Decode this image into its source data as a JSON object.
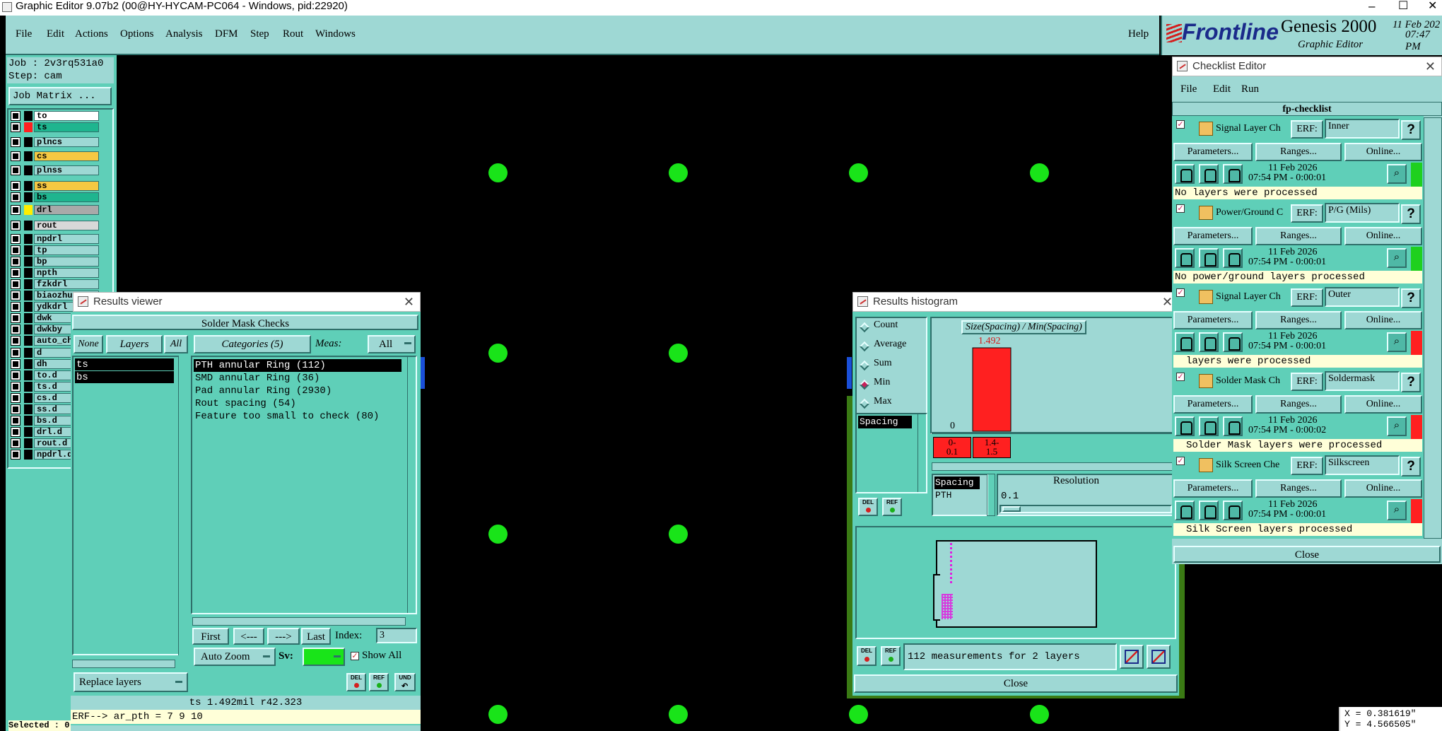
{
  "window": {
    "title": "Graphic Editor 9.07b2 (00@HY-HYCAM-PC064 - Windows, pid:22920)",
    "controls": [
      "–",
      "☐",
      "✕"
    ]
  },
  "menubar": {
    "items": [
      "File",
      "Edit",
      "Actions",
      "Options",
      "Analysis",
      "DFM",
      "Step",
      "Rout",
      "Windows"
    ],
    "help": "Help"
  },
  "brand": {
    "logo": "Frontline",
    "product": "Genesis 2000",
    "subtitle": "Graphic Editor",
    "date": "11 Feb 202",
    "time": "07:47 PM"
  },
  "job": {
    "job": "Job : 2v3rq531a0",
    "step": "Step: cam",
    "matrix_btn": "Job Matrix ..."
  },
  "layers": [
    {
      "name": "to",
      "color": "#ffffff",
      "swatch": "#000000"
    },
    {
      "name": "ts",
      "color": "#1fb58f",
      "swatch": "#ff2020"
    },
    {
      "name": "plncs",
      "color": "#9ed8d4",
      "swatch": "#000000"
    },
    {
      "name": "cs",
      "color": "#f5c842",
      "swatch": "#000000"
    },
    {
      "name": "plnss",
      "color": "#9ed8d4",
      "swatch": "#000000"
    },
    {
      "name": "ss",
      "color": "#f5c842",
      "swatch": "#000000"
    },
    {
      "name": "bs",
      "color": "#1fb58f",
      "swatch": "#000000"
    },
    {
      "name": "drl",
      "color": "#a9a9a9",
      "swatch": "#ffee00"
    },
    {
      "name": "rout",
      "color": "#d8d8d8",
      "swatch": "#000000"
    },
    {
      "name": "npdrl",
      "color": "#9ed8d4",
      "swatch": "#000000"
    },
    {
      "name": "tp",
      "color": "#9ed8d4",
      "swatch": "#000000"
    },
    {
      "name": "bp",
      "color": "#9ed8d4",
      "swatch": "#000000"
    },
    {
      "name": "npth",
      "color": "#9ed8d4",
      "swatch": "#000000"
    },
    {
      "name": "fzkdrl",
      "color": "#9ed8d4",
      "swatch": "#000000"
    },
    {
      "name": "biaozhu",
      "color": "#9ed8d4",
      "swatch": "#000000"
    },
    {
      "name": "ydkdrl",
      "color": "#9ed8d4",
      "swatch": "#000000"
    },
    {
      "name": "dwk",
      "color": "#9ed8d4",
      "swatch": "#000000"
    },
    {
      "name": "dwkby",
      "color": "#9ed8d4",
      "swatch": "#000000"
    },
    {
      "name": "auto_ch",
      "color": "#9ed8d4",
      "swatch": "#000000"
    },
    {
      "name": "d",
      "color": "#9ed8d4",
      "swatch": "#000000"
    },
    {
      "name": "dh",
      "color": "#9ed8d4",
      "swatch": "#000000"
    },
    {
      "name": "to.d",
      "color": "#9ed8d4",
      "swatch": "#000000"
    },
    {
      "name": "ts.d",
      "color": "#9ed8d4",
      "swatch": "#000000"
    },
    {
      "name": "cs.d",
      "color": "#9ed8d4",
      "swatch": "#000000"
    },
    {
      "name": "ss.d",
      "color": "#9ed8d4",
      "swatch": "#000000"
    },
    {
      "name": "bs.d",
      "color": "#9ed8d4",
      "swatch": "#000000"
    },
    {
      "name": "drl.d",
      "color": "#9ed8d4",
      "swatch": "#000000"
    },
    {
      "name": "rout.d",
      "color": "#9ed8d4",
      "swatch": "#000000"
    },
    {
      "name": "npdrl.d",
      "color": "#9ed8d4",
      "swatch": "#000000"
    }
  ],
  "status": {
    "selected": "Selected : 0"
  },
  "results_viewer": {
    "title": "Results viewer",
    "header": "Solder Mask Checks",
    "none": "None",
    "layers": "Layers",
    "all": "All",
    "layer_list": [
      "ts",
      "bs"
    ],
    "categories_btn": "Categories (5)",
    "meas_label": "Meas:",
    "meas_value": "All",
    "categories": [
      "PTH annular Ring (112)",
      "SMD annular Ring (36)",
      "Pad annular Ring (2930)",
      "Rout spacing (54)",
      "Feature too small to check (80)"
    ],
    "first": "First",
    "prev": "<---",
    "next": "--->",
    "last": "Last",
    "index_label": "Index:",
    "index_value": "3",
    "auto_zoom": "Auto Zoom",
    "sv_label": "Sv:",
    "show_all": "Show All",
    "replace_layers": "Replace layers",
    "btn_del": "DEL",
    "btn_ref": "REF",
    "btn_und": "UND",
    "info_line": "ts 1.492mil  r42.323",
    "erf_line": "ERF--> ar_pth = 7 9 10"
  },
  "histogram": {
    "title": "Results histogram",
    "options": [
      {
        "label": "Count",
        "on": false
      },
      {
        "label": "Average",
        "on": false
      },
      {
        "label": "Sum",
        "on": false
      },
      {
        "label": "Min",
        "on": true
      },
      {
        "label": "Max",
        "on": false
      }
    ],
    "measure_list": [
      "Spacing"
    ],
    "chart_title": "Size(Spacing) / Min(Spacing)",
    "bar_value": "1.492",
    "zero_label": "0",
    "bins": [
      "0-\n0.1",
      "1.4-\n1.5"
    ],
    "lower_list": [
      "Spacing",
      "PTH"
    ],
    "resolution_label": "Resolution",
    "resolution_value": "0.1",
    "measurements": "112 measurements for 2 layers",
    "close": "Close",
    "chart_data": {
      "type": "bar",
      "title": "Size(Spacing) / Min(Spacing)",
      "categories": [
        "0-0.1",
        "1.4-1.5"
      ],
      "values": [
        0,
        1.492
      ]
    }
  },
  "checklist": {
    "title": "Checklist Editor",
    "menu": [
      "File",
      "Edit",
      "Run"
    ],
    "name": "fp-checklist",
    "params": "Parameters...",
    "ranges": "Ranges...",
    "online": "Online...",
    "erf_label": "ERF:",
    "items": [
      {
        "name": "Signal Layer Ch",
        "erf": "Inner",
        "date": "11 Feb 2026",
        "time": "07:54 PM - 0:00:01",
        "message": "No layers were processed",
        "status": "#1fd01f",
        "checked": true
      },
      {
        "name": "Power/Ground C",
        "erf": "P/G (Mils)",
        "date": "11 Feb 2026",
        "time": "07:54 PM - 0:00:01",
        "message": "No power/ground layers processed",
        "status": "#1fd01f",
        "checked": true
      },
      {
        "name": "Signal Layer Ch",
        "erf": "Outer",
        "date": "11 Feb 2026",
        "time": "07:54 PM - 0:00:01",
        "message": "layers were processed",
        "status": "#ff2020",
        "checked": true
      },
      {
        "name": "Solder Mask Ch",
        "erf": "Soldermask",
        "date": "11 Feb 2026",
        "time": "07:54 PM - 0:00:02",
        "message": "Solder Mask layers were processed",
        "status": "#ff2020",
        "checked": true
      },
      {
        "name": "Silk Screen Che",
        "erf": "Silkscreen",
        "date": "11 Feb 2026",
        "time": "07:54 PM - 0:00:01",
        "message": "Silk Screen layers processed",
        "status": "#ff2020",
        "checked": true
      }
    ],
    "close": "Close"
  },
  "coords": {
    "x": "X = 0.381619\"",
    "y": "Y = 4.566505\""
  }
}
